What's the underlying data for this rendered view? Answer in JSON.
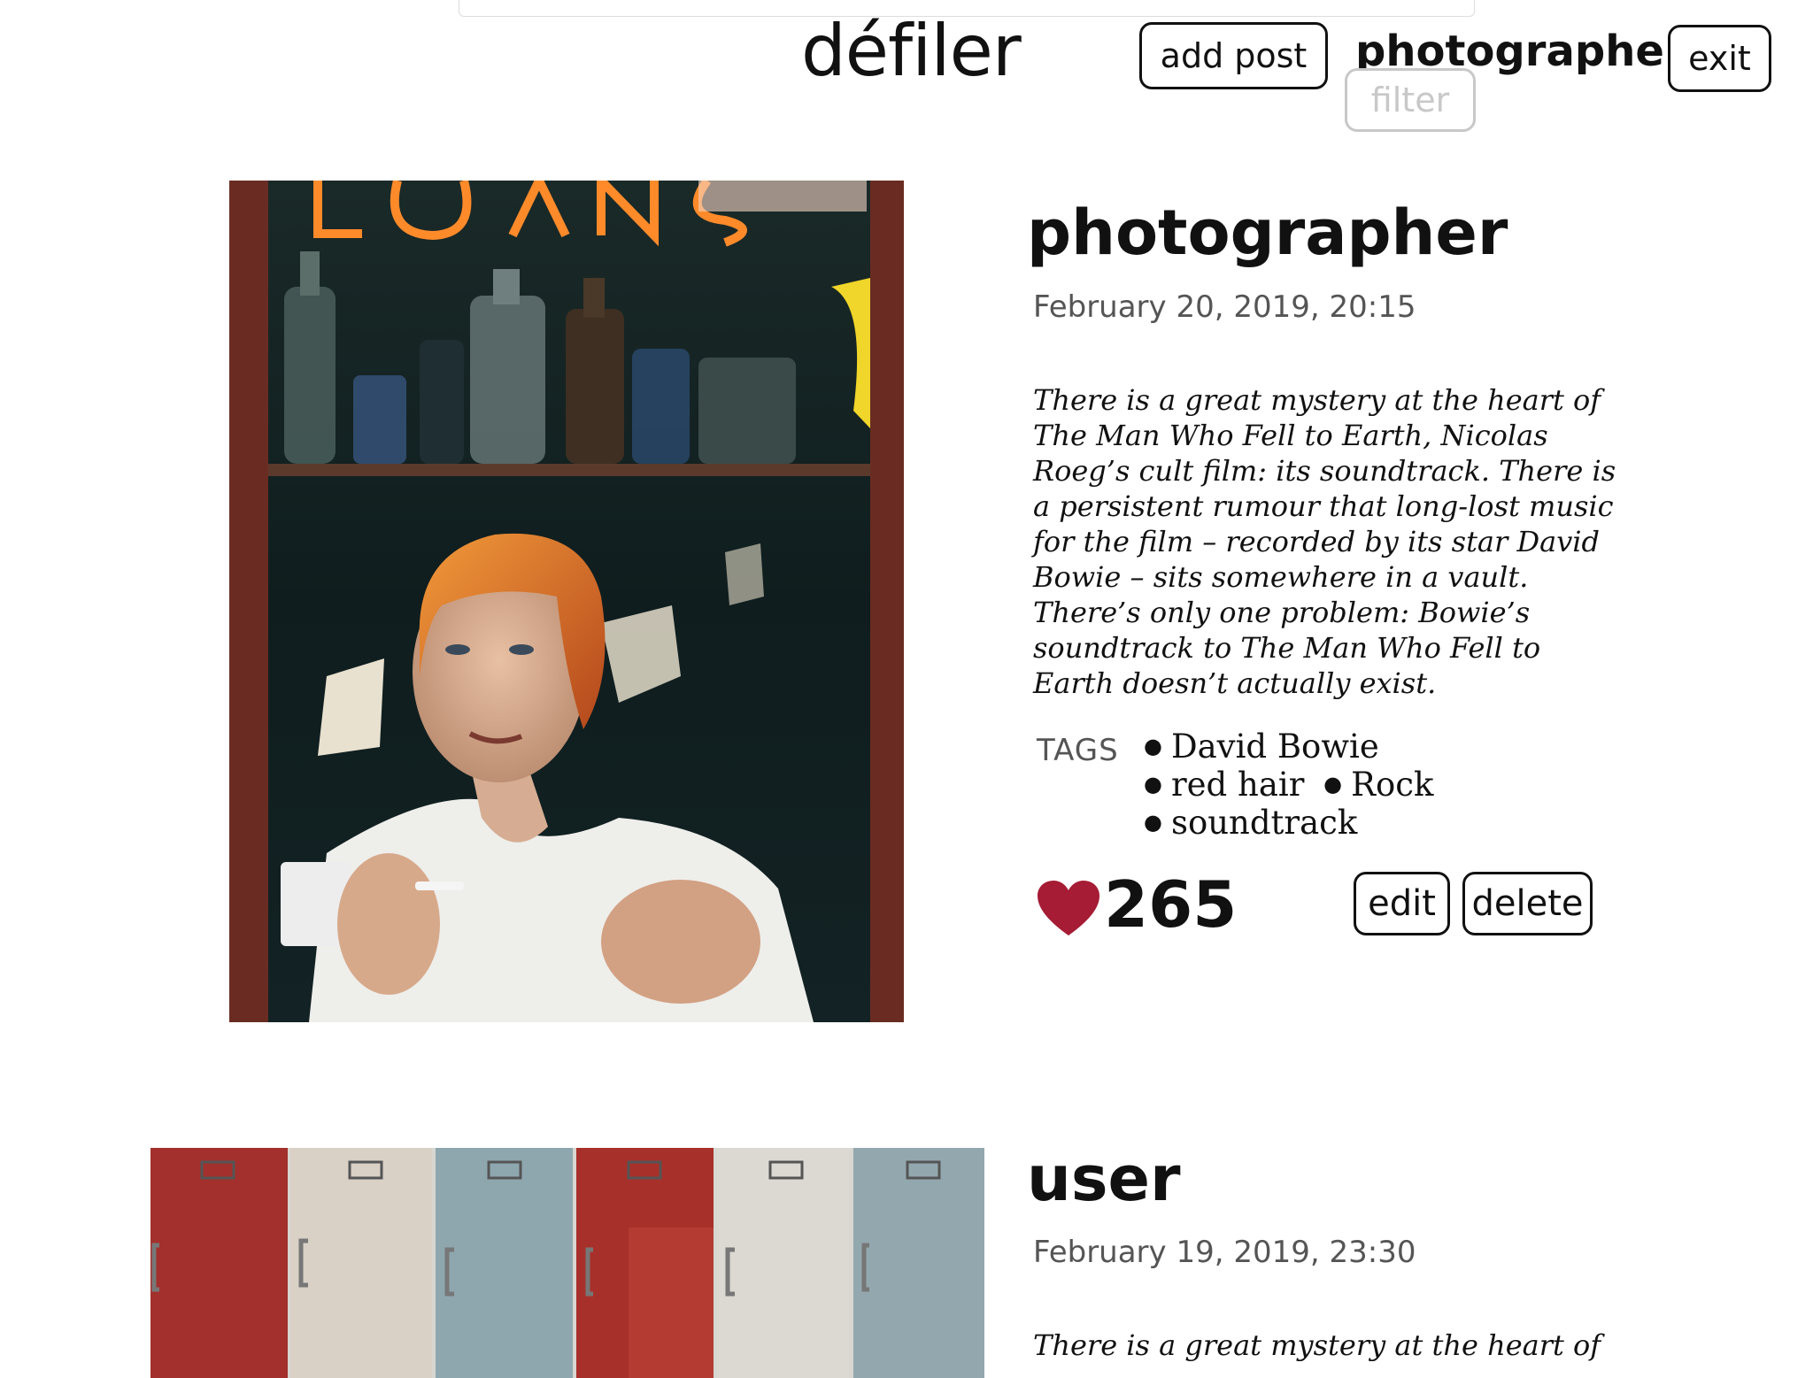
{
  "header": {
    "brand": "défiler",
    "add_post_label": "add post",
    "username": "photographer",
    "exit_label": "exit",
    "filter_label": "filter"
  },
  "posts": [
    {
      "author": "photographer",
      "date": "February 20, 2019, 20:15",
      "body": "There is a great mystery at the heart of The Man Who Fell to Earth, Nicolas Roeg’s cult film: its soundtrack. There is a persistent rumour that long-lost music for the film – recorded by its star David Bowie – sits somewhere in a vault. There’s only one problem: Bowie’s soundtrack to The Man Who Fell to Earth doesn’t actually exist.",
      "tags_label": "TAGS",
      "tags": [
        "David Bowie",
        "red hair",
        "Rock",
        "soundtrack"
      ],
      "likes": "265",
      "edit_label": "edit",
      "delete_label": "delete",
      "image": "photo-red-haired-man-at-shop-window"
    },
    {
      "author": "user",
      "date": "February 19, 2019, 23:30",
      "body": "There is a great mystery at the heart of",
      "image": "photo-colored-lockers"
    }
  ],
  "colors": {
    "heart": "#a51c34",
    "text": "#111111",
    "muted": "#555555",
    "filter": "#c8c8c8"
  },
  "icons": {
    "like": "heart-icon"
  }
}
